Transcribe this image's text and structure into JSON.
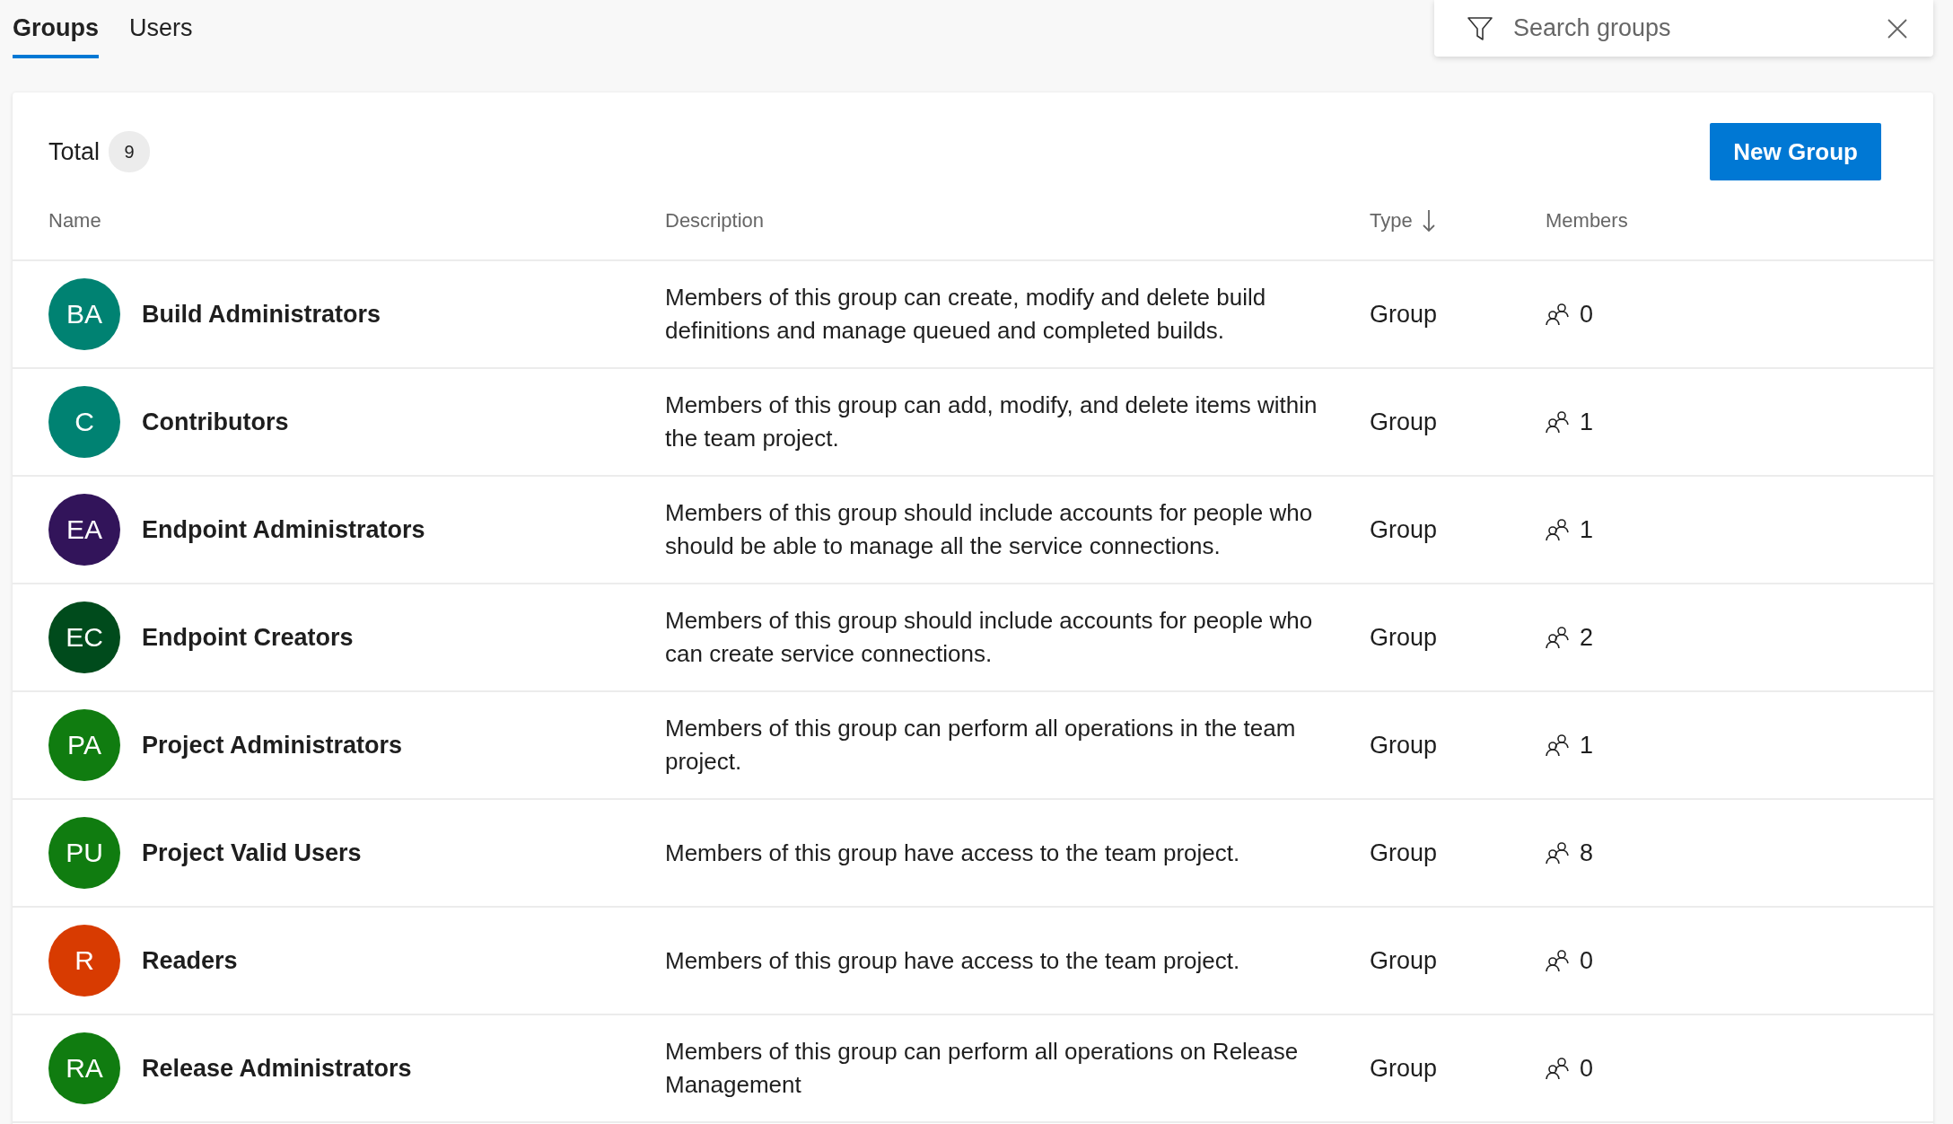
{
  "tabs": [
    {
      "label": "Groups",
      "selected": true
    },
    {
      "label": "Users",
      "selected": false
    }
  ],
  "search": {
    "placeholder": "Search groups"
  },
  "total": {
    "label": "Total",
    "count": "9"
  },
  "new_group_button": "New Group",
  "table": {
    "columns": [
      {
        "label": "Name",
        "sorted": false
      },
      {
        "label": "Description",
        "sorted": false
      },
      {
        "label": "Type",
        "sorted": true
      },
      {
        "label": "Members",
        "sorted": false
      }
    ],
    "rows": [
      {
        "initials": "BA",
        "color": "#008272",
        "name": "Build Administrators",
        "description": "Members of this group can create, modify and delete build definitions and manage queued and completed builds.",
        "type": "Group",
        "members": "0"
      },
      {
        "initials": "C",
        "color": "#008272",
        "name": "Contributors",
        "description": "Members of this group can add, modify, and delete items within the team project.",
        "type": "Group",
        "members": "1"
      },
      {
        "initials": "EA",
        "color": "#32145a",
        "name": "Endpoint Administrators",
        "description": "Members of this group should include accounts for people who should be able to manage all the service connections.",
        "type": "Group",
        "members": "1"
      },
      {
        "initials": "EC",
        "color": "#004b1c",
        "name": "Endpoint Creators",
        "description": "Members of this group should include accounts for people who can create service connections.",
        "type": "Group",
        "members": "2"
      },
      {
        "initials": "PA",
        "color": "#107c10",
        "name": "Project Administrators",
        "description": "Members of this group can perform all operations in the team project.",
        "type": "Group",
        "members": "1"
      },
      {
        "initials": "PU",
        "color": "#107c10",
        "name": "Project Valid Users",
        "description": "Members of this group have access to the team project.",
        "type": "Group",
        "members": "8"
      },
      {
        "initials": "R",
        "color": "#d83b01",
        "name": "Readers",
        "description": "Members of this group have access to the team project.",
        "type": "Group",
        "members": "0"
      },
      {
        "initials": "RA",
        "color": "#107c10",
        "name": "Release Administrators",
        "description": "Members of this group can perform all operations on Release Management",
        "type": "Group",
        "members": "0"
      }
    ]
  }
}
